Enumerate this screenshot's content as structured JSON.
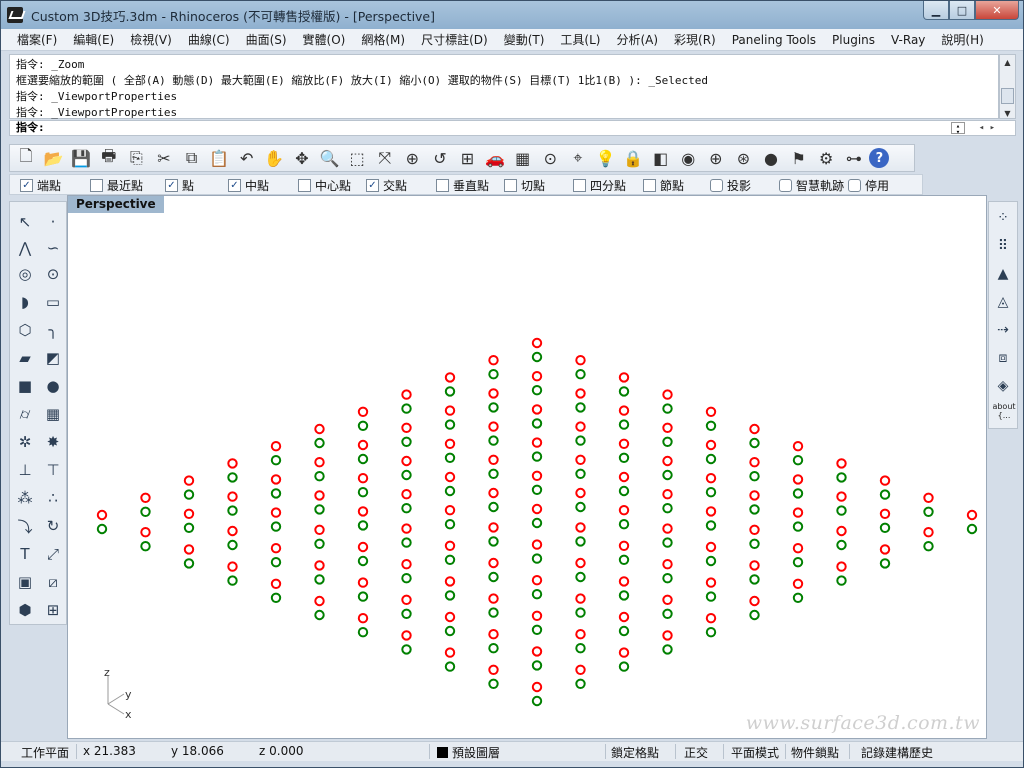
{
  "window": {
    "title": "Custom 3D技巧.3dm - Rhinoceros (不可轉售授權版) - [Perspective]",
    "buttons": {
      "minimize": "▁",
      "maximize": "□",
      "close": "✕"
    }
  },
  "menu": [
    "檔案(F)",
    "編輯(E)",
    "檢視(V)",
    "曲線(C)",
    "曲面(S)",
    "實體(O)",
    "網格(M)",
    "尺寸標註(D)",
    "變動(T)",
    "工具(L)",
    "分析(A)",
    "彩現(R)",
    "Paneling Tools",
    "Plugins",
    "V-Ray",
    "說明(H)"
  ],
  "command_history": [
    "指令: _Zoom",
    "框選要縮放的範圍 ( 全部(A) 動態(D) 最大範圍(E) 縮放比(F) 放大(I) 縮小(O) 選取的物件(S) 目標(T) 1比1(B) ): _Selected",
    "指令: _ViewportProperties",
    "指令: _ViewportProperties"
  ],
  "command_prompt": "指令:",
  "toolbar_icons": [
    "new-icon",
    "open-icon",
    "save-icon",
    "print-icon",
    "import-icon",
    "cut-icon",
    "copy-icon",
    "paste-icon",
    "undo-icon",
    "pan-icon",
    "rotate-view-icon",
    "zoom-icon",
    "zoom-window-icon",
    "zoom-extents-icon",
    "zoom-selected-icon",
    "undo-view-icon",
    "four-viewports-icon",
    "car-icon",
    "grid-icon",
    "circle-point-icon",
    "snap-icon",
    "light-bulb-icon",
    "lock-icon",
    "layer-icon",
    "color-wheel-icon",
    "sphere-wire-icon",
    "sphere-mesh-icon",
    "sphere-shaded-icon",
    "flag-icon",
    "gear-icon",
    "flowchart-icon",
    "help-icon"
  ],
  "osnaps": [
    {
      "label": "端點",
      "checked": true
    },
    {
      "label": "最近點",
      "checked": false
    },
    {
      "label": "點",
      "checked": true
    },
    {
      "label": "中點",
      "checked": true
    },
    {
      "label": "中心點",
      "checked": false
    },
    {
      "label": "交點",
      "checked": true
    },
    {
      "label": "垂直點",
      "checked": false
    },
    {
      "label": "切點",
      "checked": false
    },
    {
      "label": "四分點",
      "checked": false
    },
    {
      "label": "節點",
      "checked": false
    },
    {
      "label": "投影",
      "checked": false
    },
    {
      "label": "智慧軌跡",
      "checked": false
    },
    {
      "label": "停用",
      "checked": false
    }
  ],
  "viewport": {
    "name": "Perspective",
    "axes": {
      "z": "z",
      "y": "y",
      "x": "x"
    },
    "point_colors": {
      "upper": "#ff0000",
      "lower": "#008000"
    }
  },
  "about_label": "about {...",
  "watermark": "www.surface3d.com.tw",
  "status": {
    "cplane": "工作平面",
    "x": "x 21.383",
    "y": "y 18.066",
    "z": "z 0.000",
    "layer": "預設圖層",
    "grid_snap": "鎖定格點",
    "ortho": "正交",
    "planar": "平面模式",
    "osnap": "物件鎖點",
    "history": "記錄建構歷史"
  }
}
